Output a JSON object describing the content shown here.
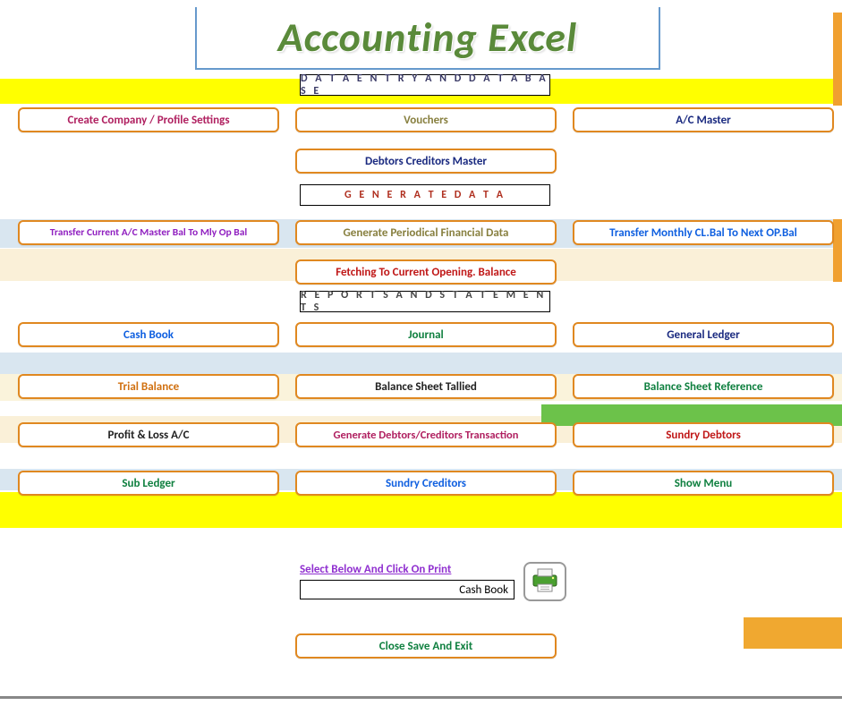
{
  "title": "Accounting Excel",
  "sections": {
    "data_entry": "D A T A E N T R Y  A N D  D A T A B A S E",
    "generate": "G E N E R A T E   D A T A",
    "reports": "R E P O R T S   A N D   S T A T E M E N T S"
  },
  "buttons": {
    "create_company": "Create Company / Profile Settings",
    "vouchers": "Vouchers",
    "ac_master": "A/C  Master",
    "debtors_creditors_master": "Debtors Creditors Master",
    "transfer_current": "Transfer Current  A/C Master  Bal   To Mly Op Bal",
    "generate_periodical": "Generate Periodical Financial Data",
    "transfer_monthly": "Transfer Monthly  CL.Bal To Next OP.Bal",
    "fetching": "Fetching  To Current Opening. Balance",
    "cash_book": "Cash Book",
    "journal": "Journal",
    "general_ledger": "General Ledger",
    "trial_balance": "Trial Balance",
    "balance_sheet_tallied": "Balance Sheet Tallied",
    "balance_sheet_ref": "Balance Sheet Reference",
    "profit_loss": "Profit & Loss A/C",
    "gen_debtors_creditors": "Generate Debtors/Creditors Transaction",
    "sundry_debtors": "Sundry Debtors",
    "sub_ledger": "Sub Ledger",
    "sundry_creditors": "Sundry Creditors",
    "show_menu": "Show Menu",
    "close_save_exit": "Close Save And Exit"
  },
  "print": {
    "label": "Select Below And Click On Print",
    "selected": "Cash Book"
  }
}
